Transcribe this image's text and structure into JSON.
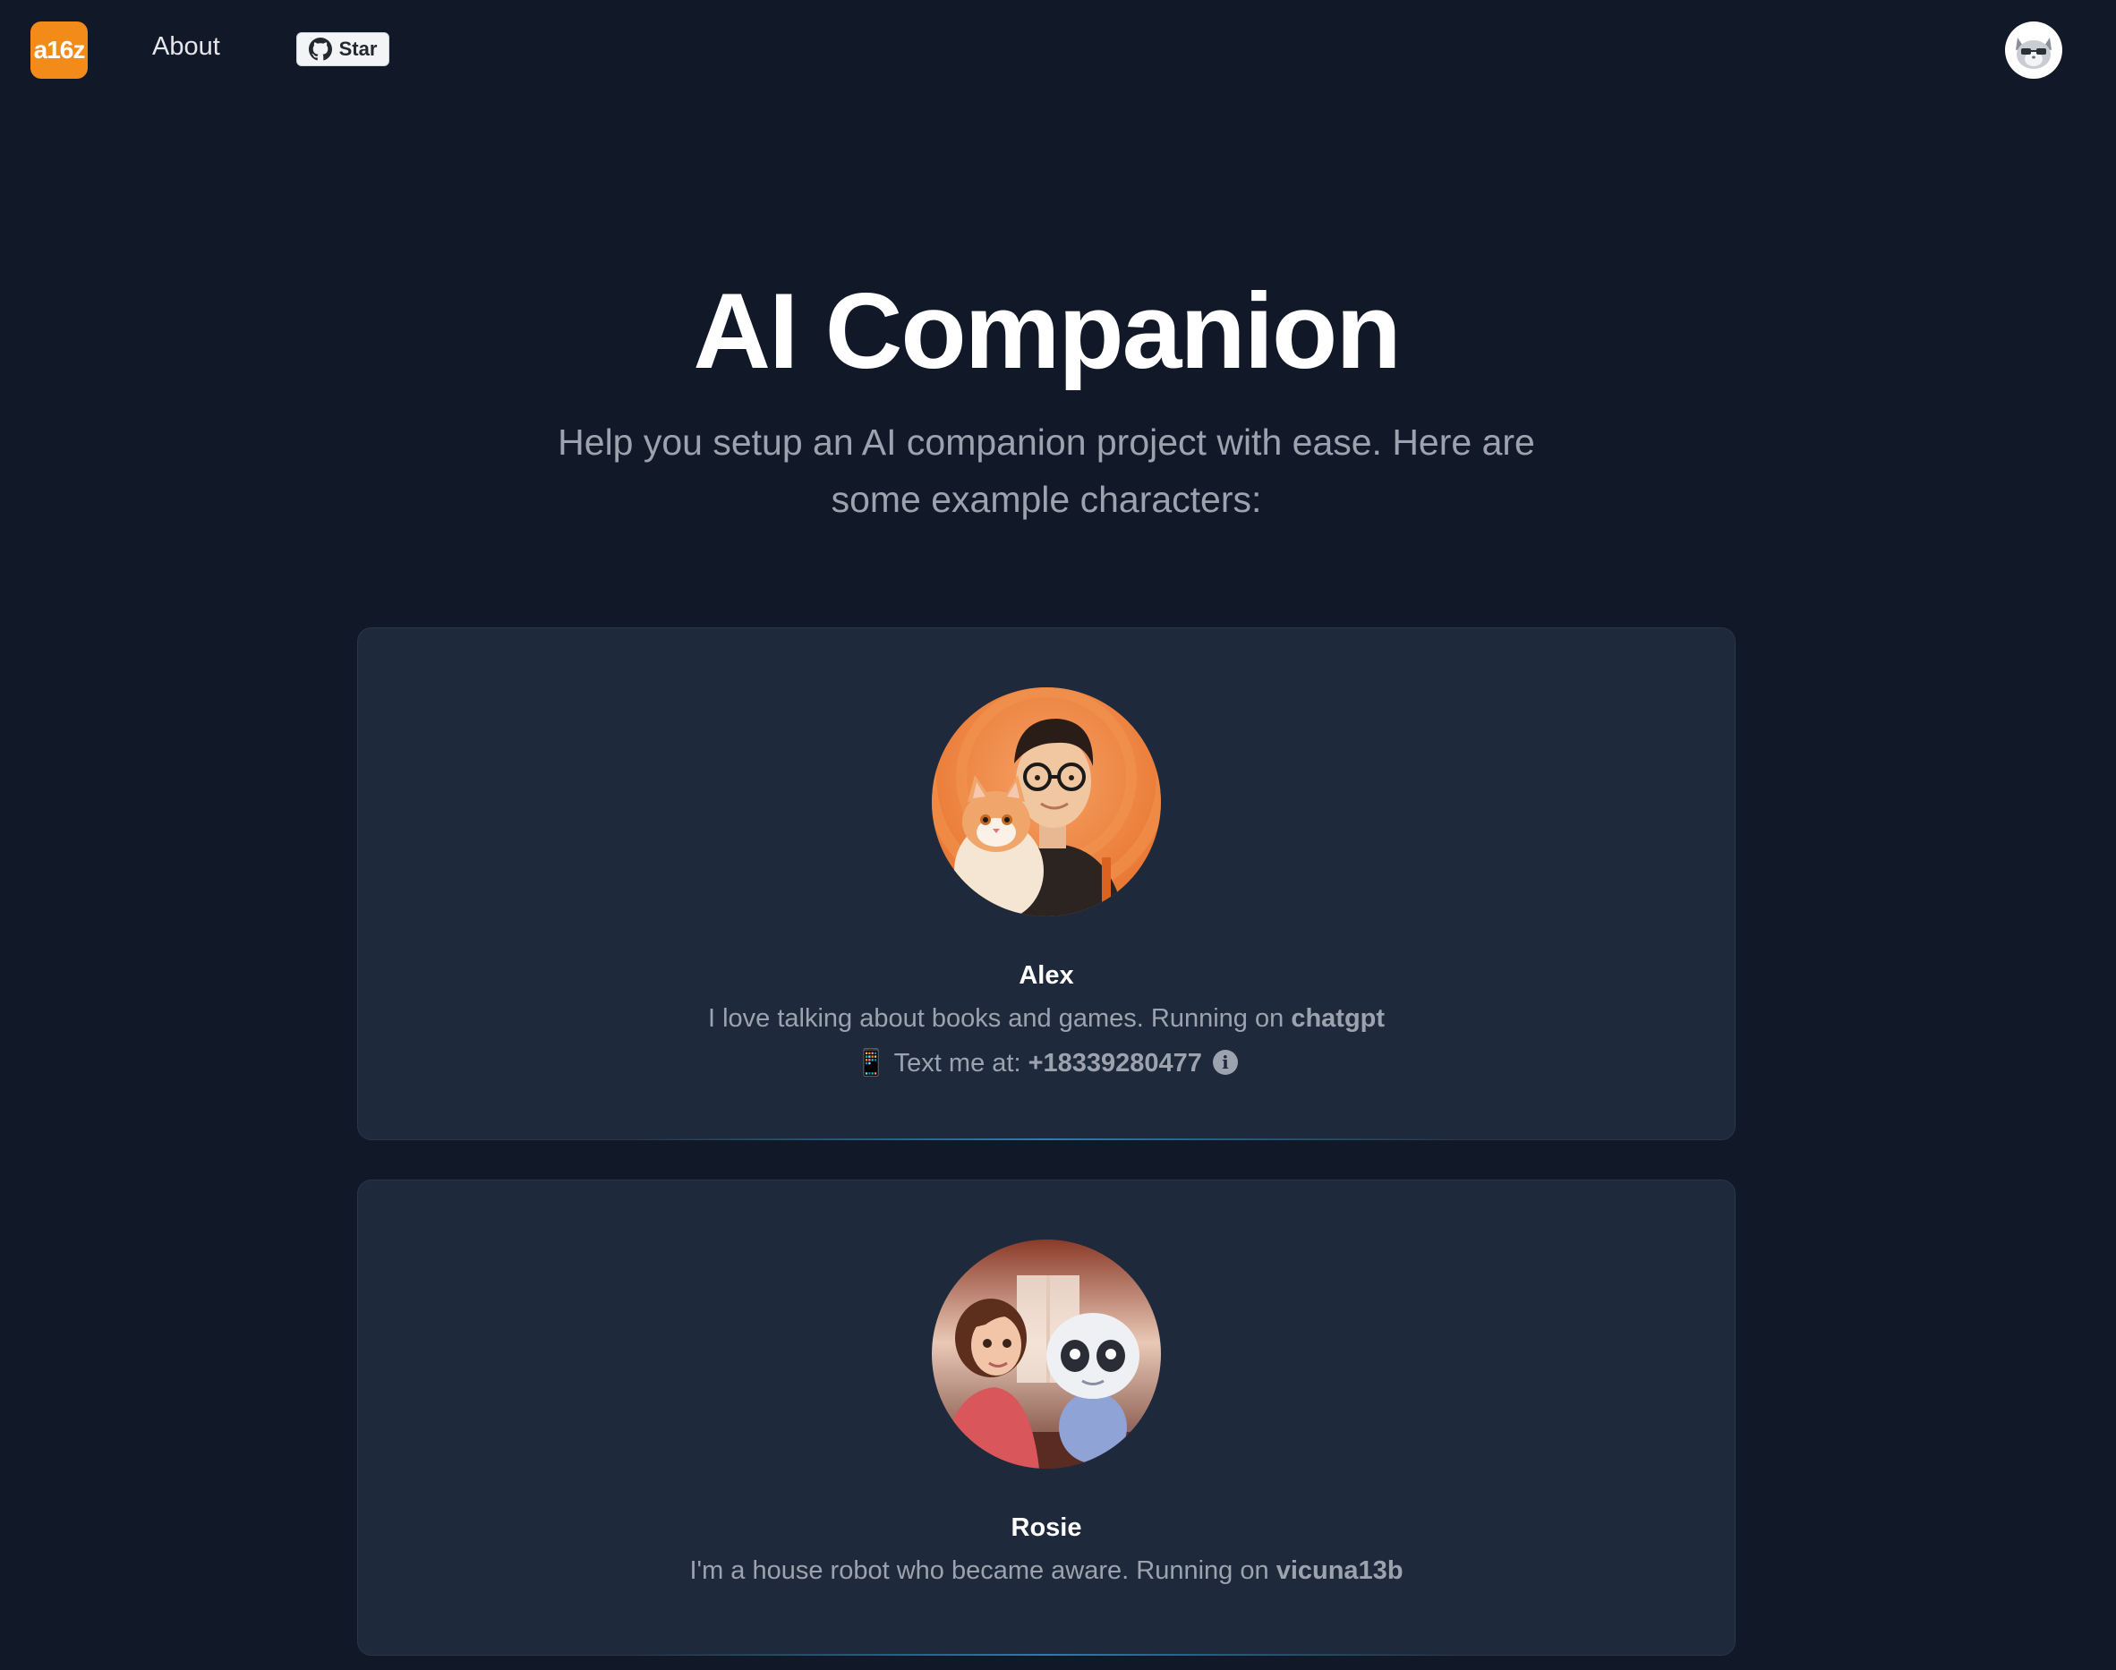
{
  "nav": {
    "logo_text": "a16z",
    "about_label": "About",
    "star_label": "Star"
  },
  "hero": {
    "title": "AI Companion",
    "subtitle": "Help you setup an AI companion project with ease. Here are some example characters:"
  },
  "characters": [
    {
      "name": "Alex",
      "description": "I love talking about books and games. Running on",
      "model": "chatgpt",
      "phone_icon": "📱",
      "phone_prefix": "Text me at:",
      "phone": "+18339280477",
      "info_icon": "i"
    },
    {
      "name": "Rosie",
      "description": "I'm a house robot who became aware. Running on",
      "model": "vicuna13b"
    }
  ],
  "colors": {
    "background": "#111827",
    "card": "#1e293b",
    "logo": "#f28b1a",
    "text_muted": "#9ca3af"
  }
}
